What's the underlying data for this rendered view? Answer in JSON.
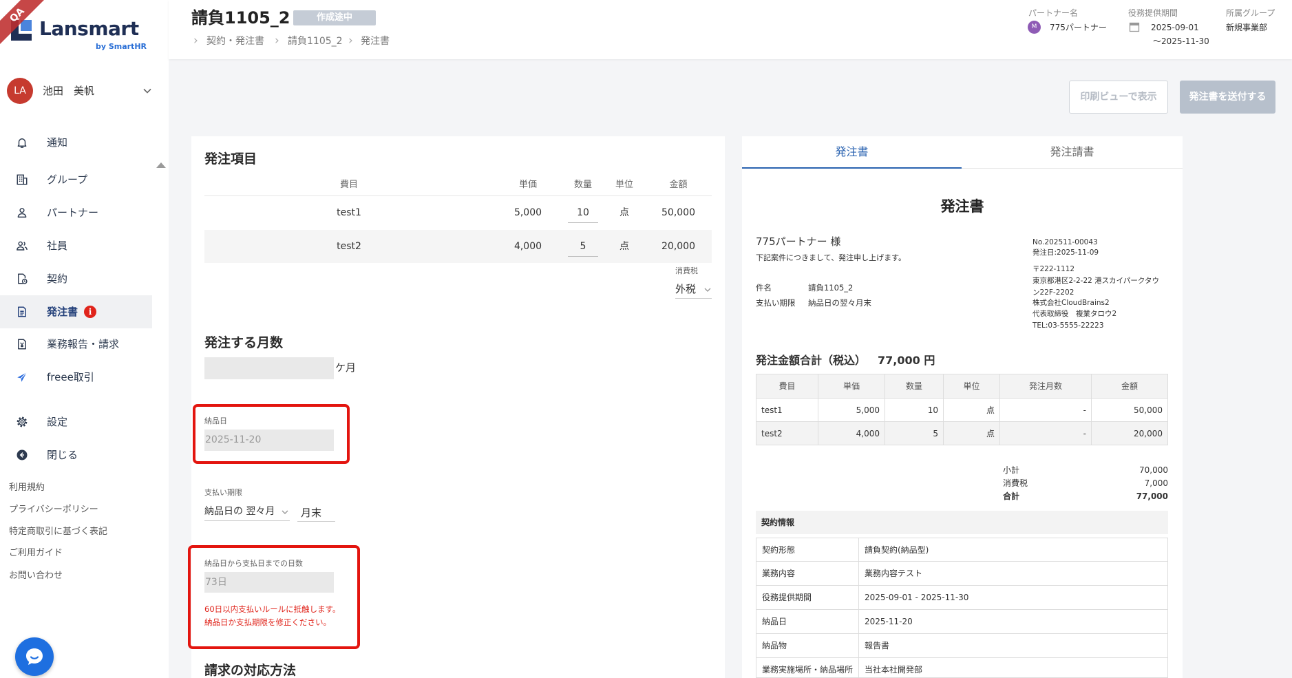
{
  "app": {
    "ribbon": "QA",
    "logo_text": "Lansmart",
    "logo_sub": "by SmartHR"
  },
  "colors": {
    "accent": "#2962b0",
    "error": "#e0241b",
    "annotation": "#e3150f",
    "user_avatar": "#c63a2f",
    "partner_avatar": "#8e5bb5",
    "chat": "#1e6fe0"
  },
  "user": {
    "initials": "LA",
    "name": "池田　美帆"
  },
  "nav": [
    {
      "label": "通知",
      "icon": "bell-icon"
    },
    {
      "label": "グループ",
      "icon": "building-icon"
    },
    {
      "label": "パートナー",
      "icon": "person-icon"
    },
    {
      "label": "社員",
      "icon": "people-icon"
    },
    {
      "label": "契約",
      "icon": "contract-icon"
    },
    {
      "label": "発注書",
      "icon": "document-icon",
      "active": true,
      "badge": "i"
    },
    {
      "label": "業務報告・請求",
      "icon": "invoice-icon"
    },
    {
      "label": "freee取引",
      "icon": "freee-icon"
    },
    {
      "label": "設定",
      "icon": "gear-icon"
    },
    {
      "label": "閉じる",
      "icon": "collapse-icon"
    }
  ],
  "footer_links": [
    "利用規約",
    "プライバシーポリシー",
    "特定商取引に基づく表記",
    "ご利用ガイド",
    "お問い合わせ"
  ],
  "header": {
    "title": "請負1105_2",
    "status": "作成途中",
    "breadcrumb": [
      "契約・発注書",
      "請負1105_2",
      "発注書"
    ],
    "partner_label": "パートナー名",
    "partner_initial": "M",
    "partner_name": "775パートナー",
    "period_label": "役務提供期間",
    "period_start": "2025-09-01",
    "period_end": "～2025-11-30",
    "group_label": "所属グループ",
    "group_name": "新規事業部"
  },
  "actions": {
    "print": "印刷ビューで表示",
    "send": "発注書を送付する"
  },
  "form": {
    "items_title": "発注項目",
    "columns": [
      "費目",
      "単価",
      "数量",
      "単位",
      "金額"
    ],
    "rows": [
      {
        "item": "test1",
        "unit_price": "5,000",
        "qty": "10",
        "unit": "点",
        "amount": "50,000"
      },
      {
        "item": "test2",
        "unit_price": "4,000",
        "qty": "5",
        "unit": "点",
        "amount": "20,000"
      }
    ],
    "tax_label": "消費税",
    "tax_value": "外税",
    "months_title": "発注する月数",
    "months_suffix": "ケ月",
    "delivery_label": "納品日",
    "delivery_value": "2025-11-20",
    "due_label": "支払い期限",
    "due_select": "納品日の 翌々月",
    "due_day": "月末",
    "days_label": "納品日から支払日までの日数",
    "days_value": "73日",
    "error_lines": [
      "60日以内支払いルールに抵触します。",
      "納品日か支払期限を修正ください。"
    ],
    "billing_title": "請求の対応方法"
  },
  "preview": {
    "tabs": [
      "発注書",
      "発注請書"
    ],
    "doc_title": "発注書",
    "recipient": "775パートナー 様",
    "intro": "下記案件につきまして、発注申し上げます。",
    "issuer_lines": [
      "No.202511-00043",
      "発注日:2025-11-09",
      "〒222-1112",
      "東京都港区2-2-22 港スカイパークタウ",
      "ン22F-2202",
      "株式会社CloudBrains2",
      "代表取締役　複業タロウ2",
      "TEL:03-5555-22223"
    ],
    "subject_label": "件名",
    "subject": "請負1105_2",
    "due_label": "支払い期限",
    "due": "納品日の翌々月末",
    "total_label": "発注金額合計（税込）",
    "total": "77,000 円",
    "columns": [
      "費目",
      "単価",
      "数量",
      "単位",
      "発注月数",
      "金額"
    ],
    "rows": [
      [
        "test1",
        "5,000",
        "10",
        "点",
        "-",
        "50,000"
      ],
      [
        "test2",
        "4,000",
        "5",
        "点",
        "-",
        "20,000"
      ]
    ],
    "summary": [
      {
        "label": "小計",
        "value": "70,000"
      },
      {
        "label": "消費税",
        "value": "7,000"
      },
      {
        "label": "合計",
        "value": "77,000"
      }
    ],
    "contract_title": "契約情報",
    "contract_rows": [
      [
        "契約形態",
        "請負契約(納品型)"
      ],
      [
        "業務内容",
        "業務内容テスト"
      ],
      [
        "役務提供期間",
        "2025-09-01 - 2025-11-30"
      ],
      [
        "納品日",
        "2025-11-20"
      ],
      [
        "納品物",
        "報告書"
      ],
      [
        "業務実施場所・納品場所",
        "当社本社開発部"
      ]
    ]
  }
}
